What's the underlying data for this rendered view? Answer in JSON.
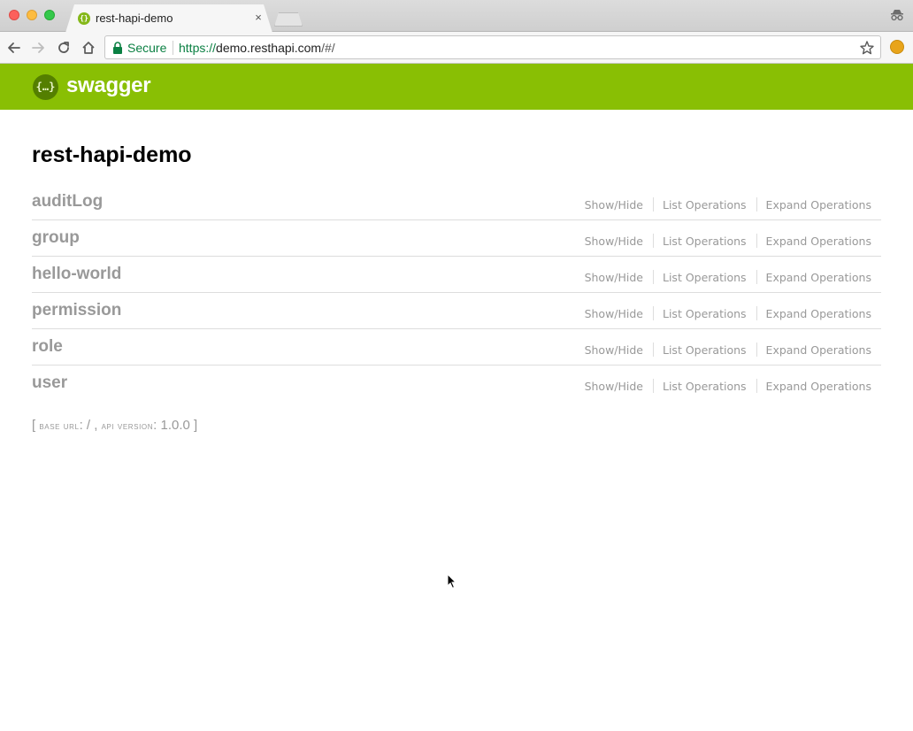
{
  "browser": {
    "tab_title": "rest-hapi-demo",
    "tab_close": "×",
    "secure_label": "Secure",
    "url_scheme": "https://",
    "url_host": "demo.resthapi.com",
    "url_path": "/#/"
  },
  "header": {
    "logo_mark": "{…}",
    "logo_text": "swagger",
    "brand_color": "#89bf04"
  },
  "api": {
    "title": "rest-hapi-demo"
  },
  "resources": [
    {
      "name": "auditLog",
      "show_hide": "Show/Hide",
      "list_ops": "List Operations",
      "expand_ops": "Expand Operations"
    },
    {
      "name": "group",
      "show_hide": "Show/Hide",
      "list_ops": "List Operations",
      "expand_ops": "Expand Operations"
    },
    {
      "name": "hello-world",
      "show_hide": "Show/Hide",
      "list_ops": "List Operations",
      "expand_ops": "Expand Operations"
    },
    {
      "name": "permission",
      "show_hide": "Show/Hide",
      "list_ops": "List Operations",
      "expand_ops": "Expand Operations"
    },
    {
      "name": "role",
      "show_hide": "Show/Hide",
      "list_ops": "List Operations",
      "expand_ops": "Expand Operations"
    },
    {
      "name": "user",
      "show_hide": "Show/Hide",
      "list_ops": "List Operations",
      "expand_ops": "Expand Operations"
    }
  ],
  "footer": {
    "open_bracket": "[ ",
    "base_url_label": "base url",
    "base_url_value": ": / , ",
    "api_version_label": "api version",
    "api_version_value": ": 1.0.0 ",
    "close_bracket": "]"
  }
}
